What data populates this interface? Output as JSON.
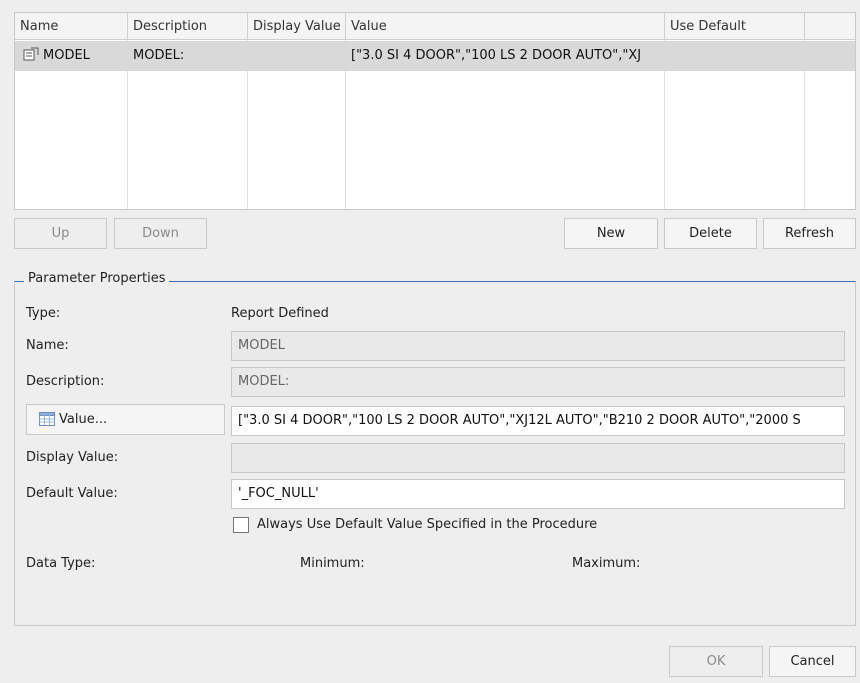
{
  "grid": {
    "columns": [
      "Name",
      "Description",
      "Display Value",
      "Value",
      "Use Default"
    ],
    "row": {
      "name": "MODEL",
      "description": "MODEL:",
      "display_value": "",
      "value": "[\"3.0 SI 4 DOOR\",\"100 LS 2 DOOR AUTO\",\"XJ",
      "use_default": ""
    }
  },
  "buttons": {
    "up": "Up",
    "down": "Down",
    "new": "New",
    "delete": "Delete",
    "refresh": "Refresh",
    "value": "Value...",
    "ok": "OK",
    "cancel": "Cancel"
  },
  "properties": {
    "legend": "Parameter Properties",
    "type_label": "Type:",
    "type_value": "Report Defined",
    "name_label": "Name:",
    "name_value": "MODEL",
    "description_label": "Description:",
    "description_value": "MODEL:",
    "value_value": "[\"3.0 SI 4 DOOR\",\"100 LS 2 DOOR AUTO\",\"XJ12L AUTO\",\"B210 2 DOOR AUTO\",\"2000 S",
    "display_value_label": "Display Value:",
    "display_value_value": "",
    "default_value_label": "Default Value:",
    "default_value_value": "'_FOC_NULL'",
    "always_default_label": "Always Use Default Value Specified in the Procedure",
    "always_default_checked": false,
    "data_type_label": "Data Type:",
    "minimum_label": "Minimum:",
    "maximum_label": "Maximum:"
  }
}
